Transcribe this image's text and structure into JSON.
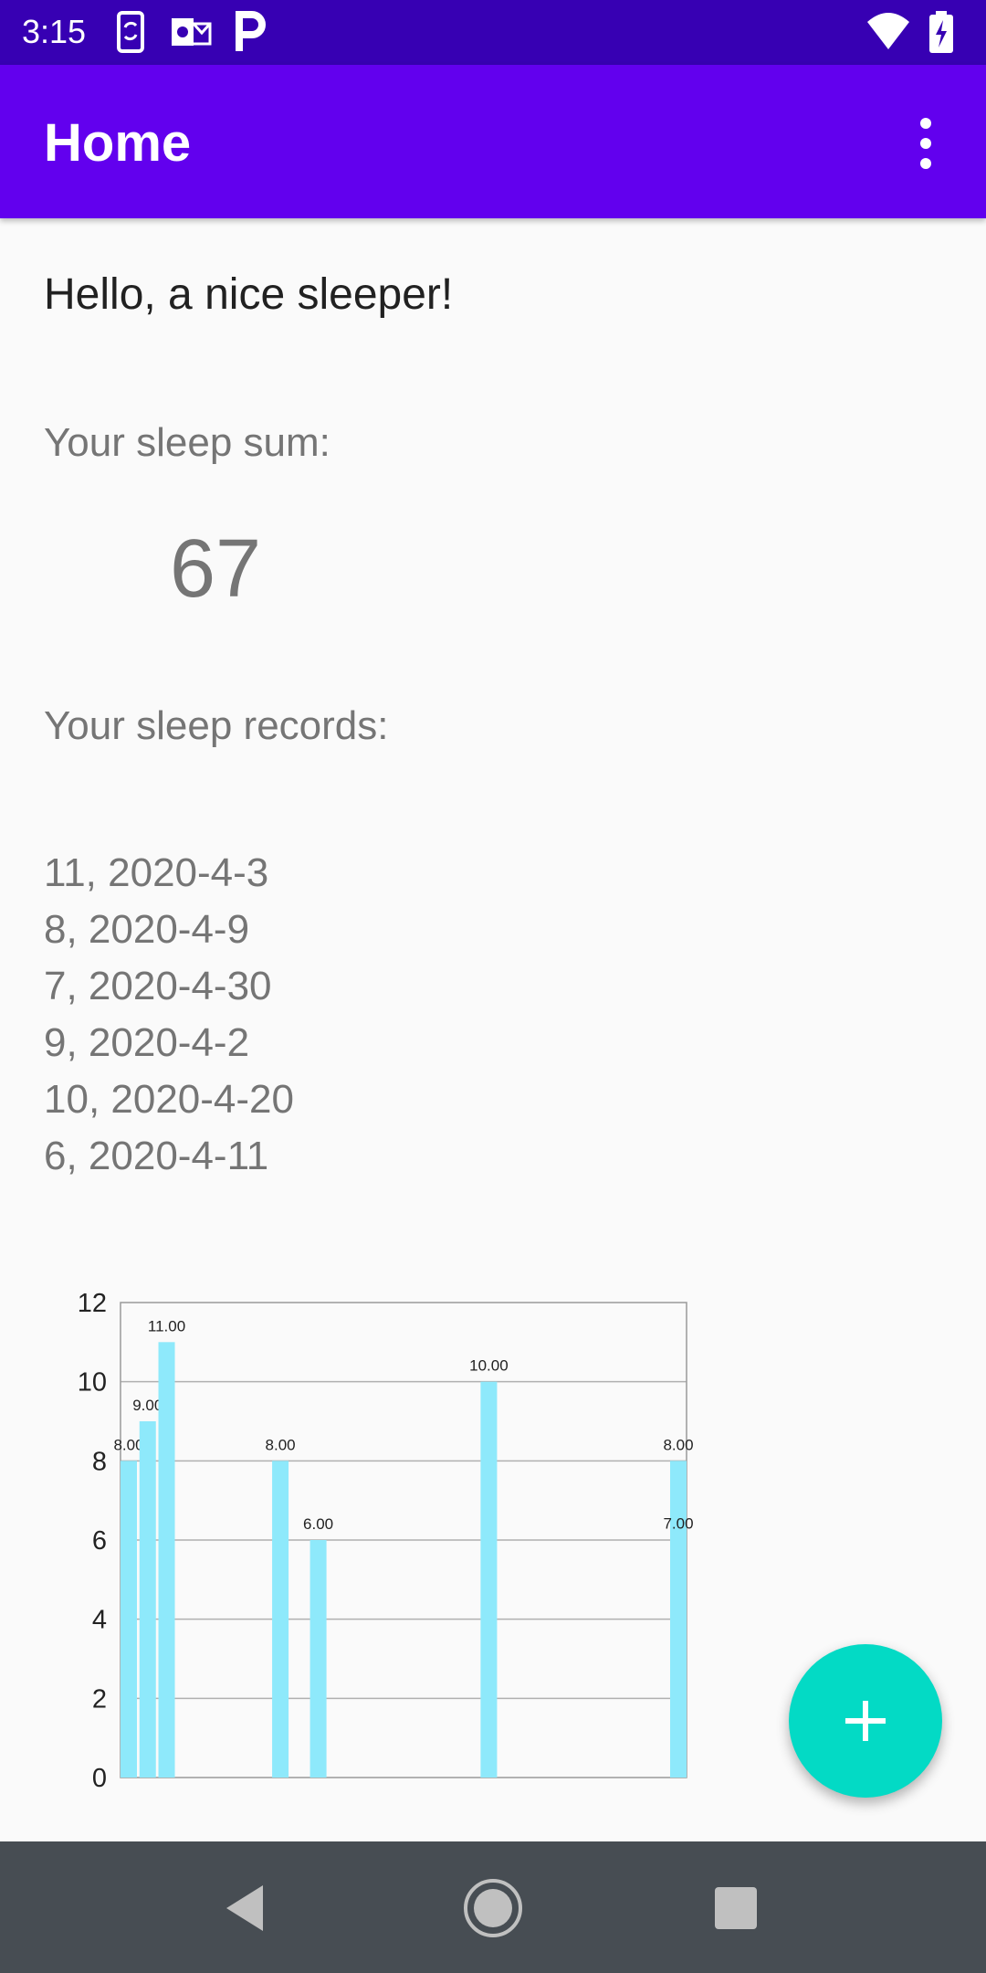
{
  "status_bar": {
    "time": "3:15",
    "left_icons": [
      "phone-sync-icon",
      "outlook-icon",
      "parking-icon"
    ],
    "right_icons": [
      "wifi-icon",
      "battery-charging-icon"
    ],
    "background": "#3700b3"
  },
  "app_bar": {
    "title": "Home",
    "menu_icon": "more-vert-icon",
    "background": "#6200ee"
  },
  "main": {
    "greeting": "Hello, a nice sleeper!",
    "sum_label": "Your sleep sum:",
    "sum_value": "67",
    "records_label": "Your sleep records:",
    "records": [
      "11, 2020-4-3",
      "8, 2020-4-9",
      "7, 2020-4-30",
      "9, 2020-4-2",
      "10, 2020-4-20",
      "6, 2020-4-11"
    ]
  },
  "chart_data": {
    "type": "bar",
    "x": [
      1,
      2,
      3,
      9,
      11,
      20,
      30,
      30
    ],
    "values": [
      8,
      9,
      11,
      8,
      6,
      10,
      8,
      7
    ],
    "value_labels": [
      "8.00",
      "9.00",
      "11.00",
      "8.00",
      "6.00",
      "10.00",
      "8.00",
      "7.00"
    ],
    "xlim": [
      1,
      30
    ],
    "ylim": [
      0,
      12
    ],
    "yticks": [
      "0",
      "2",
      "4",
      "6",
      "8",
      "10",
      "12"
    ],
    "grid": true,
    "bar_color": "#8ee9fb"
  },
  "fab": {
    "icon": "plus-icon",
    "color": "#03dac5"
  },
  "nav_bar": {
    "icons": [
      "back-icon",
      "home-icon",
      "recents-icon"
    ]
  }
}
